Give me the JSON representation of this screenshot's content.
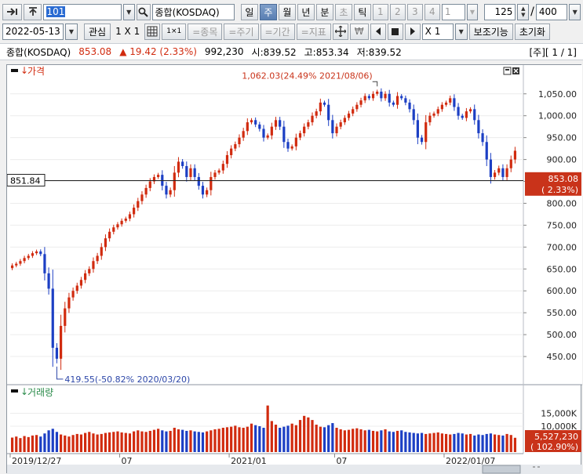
{
  "toolbar1": {
    "code": "101",
    "name": "종합(KOSDAQ)",
    "periods": [
      "일",
      "주",
      "월",
      "년",
      "분",
      "초",
      "틱"
    ],
    "selected_period": "주",
    "intervals": [
      "1",
      "2",
      "3",
      "4"
    ],
    "interval_value": "1",
    "count": "125",
    "total": "400"
  },
  "toolbar2": {
    "date": "2022-05-13",
    "watch": "관심",
    "layout": "1 X 1",
    "grid_btn": "1×1",
    "btns": [
      "=종목",
      "=주기",
      "=기간",
      "=지표"
    ],
    "currency_icon": "₩",
    "zoom": "X 1",
    "aux": "보조기능",
    "reset": "초기화"
  },
  "infobar": {
    "name": "종합(KOSDAQ)",
    "price": "853.08",
    "change": "▲ 19.42 (2.33%)",
    "volume": "992,230",
    "open": "시:839.52",
    "high": "고:853.34",
    "low": "저:839.52",
    "page": "[주][ 1 / 1]"
  },
  "colors": {
    "up": "#d12b0f",
    "down": "#1c3fc4",
    "accent": "#5a7fb3"
  },
  "chart_data": {
    "type": "candlestick",
    "price_panel": {
      "title": "가격",
      "yticks": [
        "1,050.00",
        "1,000.00",
        "950.00",
        "900.00",
        "850.00",
        "800.00",
        "750.00",
        "700.00",
        "650.00",
        "600.00",
        "550.00",
        "500.00",
        "450.00"
      ],
      "ylim": [
        400,
        1080
      ],
      "crosshair_value": "851.84",
      "last_price": "853.08",
      "last_change": "( 2.33%)",
      "annotation_high": "1,062.03(24.49% 2021/08/06)",
      "annotation_low": "419.55(-50.82% 2020/03/20)",
      "close": [
        658,
        662,
        668,
        675,
        680,
        686,
        690,
        684,
        640,
        605,
        470,
        445,
        520,
        560,
        585,
        600,
        612,
        625,
        640,
        650,
        668,
        680,
        700,
        720,
        735,
        745,
        752,
        760,
        765,
        775,
        790,
        805,
        820,
        835,
        850,
        860,
        865,
        840,
        820,
        830,
        870,
        895,
        885,
        860,
        880,
        860,
        840,
        820,
        830,
        860,
        870,
        875,
        890,
        910,
        925,
        935,
        950,
        965,
        985,
        990,
        980,
        970,
        950,
        955,
        975,
        990,
        975,
        940,
        925,
        930,
        950,
        960,
        975,
        985,
        1000,
        1010,
        1030,
        1025,
        990,
        960,
        975,
        985,
        995,
        1005,
        1015,
        1025,
        1035,
        1045,
        1040,
        1050,
        1055,
        1040,
        1050,
        1030,
        1025,
        1045,
        1040,
        1030,
        1015,
        990,
        950,
        940,
        985,
        1000,
        1005,
        1015,
        1025,
        1030,
        1040,
        1020,
        1000,
        995,
        1010,
        1015,
        990,
        960,
        940,
        900,
        860,
        870,
        880,
        860,
        880,
        900,
        920
      ],
      "volume": [
        5600,
        6000,
        5400,
        6200,
        5800,
        6400,
        6600,
        6000,
        7200,
        8400,
        9000,
        7800,
        6800,
        6400,
        6000,
        6600,
        7000,
        6800,
        7400,
        7800,
        7200,
        6800,
        7000,
        7400,
        7600,
        7800,
        8000,
        7600,
        7400,
        7200,
        8000,
        8400,
        8000,
        7800,
        8200,
        8600,
        9000,
        8400,
        8000,
        8200,
        9400,
        8800,
        8600,
        8200,
        8400,
        8000,
        7800,
        7600,
        8000,
        8400,
        8800,
        9000,
        9400,
        9600,
        9800,
        10200,
        9600,
        9400,
        9800,
        11000,
        10400,
        10000,
        9400,
        18000,
        12000,
        10600,
        9400,
        9800,
        10200,
        11000,
        10400,
        12400,
        14000,
        13400,
        12400,
        10600,
        9800,
        9600,
        10400,
        11200,
        9400,
        8800,
        8400,
        8600,
        9000,
        9200,
        8800,
        8400,
        8600,
        8200,
        8000,
        8400,
        8800,
        8000,
        7800,
        8200,
        8400,
        7800,
        7600,
        7400,
        7200,
        7400,
        7000,
        7200,
        7400,
        7600,
        7200,
        7000,
        6800,
        7000,
        7400,
        7200,
        6800,
        7000,
        6400,
        6800,
        6600,
        7000,
        7200,
        6800,
        6600,
        6400,
        7000,
        6600,
        5527
      ]
    },
    "volume_panel": {
      "title": "거래량",
      "yticks": [
        "15,000K",
        "10,000K"
      ],
      "ylim": [
        0,
        20000
      ],
      "last_volume": "5,527,230",
      "last_change": "( 102.90%)"
    },
    "x_labels": [
      "2019/12/27",
      "07",
      "2021/01",
      "07",
      "2022/01/07"
    ]
  }
}
